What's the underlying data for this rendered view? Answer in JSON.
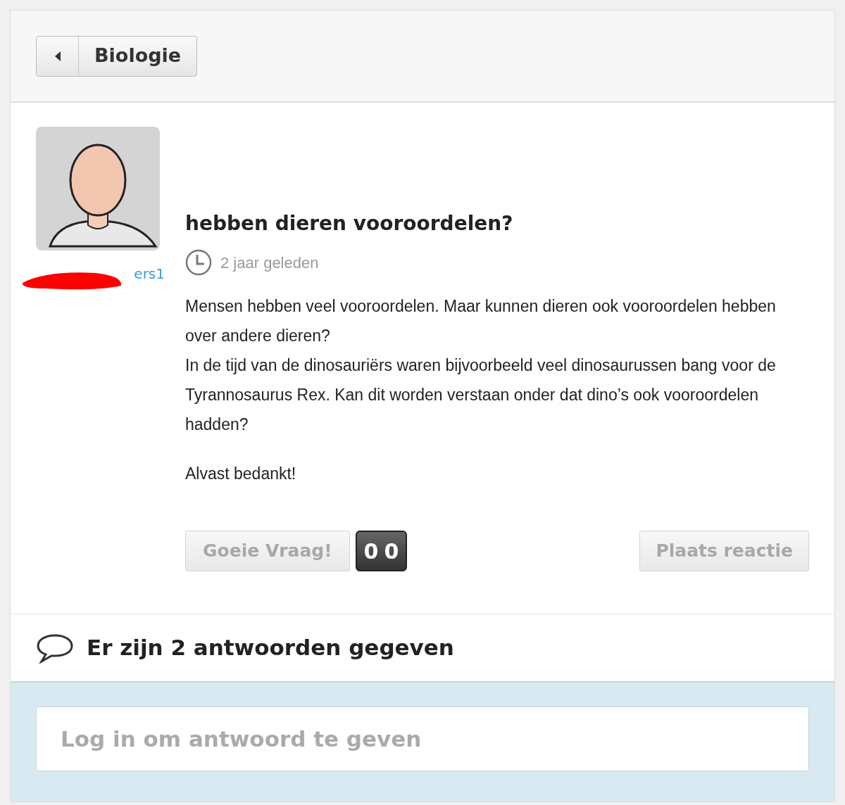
{
  "back_button": {
    "label": "Biologie"
  },
  "question": {
    "author": "ers1",
    "title": "hebben dieren vooroordelen?",
    "time": "2 jaar geleden",
    "paragraphs": [
      "Mensen hebben veel vooroordelen. Maar kunnen dieren ook vooroordelen hebben over andere dieren?",
      "In de tijd van de dinosauriërs waren bijvoorbeeld veel dinosaurussen bang voor de Tyrannosaurus Rex. Kan dit worden verstaan onder dat dino’s ook vooroordelen hadden?",
      "Alvast bedankt!"
    ],
    "vote_button": "Goeie Vraag!",
    "vote_count": [
      "0",
      "0"
    ],
    "comment_button": "Plaats reactie"
  },
  "answers": {
    "heading": "Er zijn 2 antwoorden gegeven"
  },
  "answer_field": {
    "placeholder": "Log in om antwoord te geven"
  }
}
